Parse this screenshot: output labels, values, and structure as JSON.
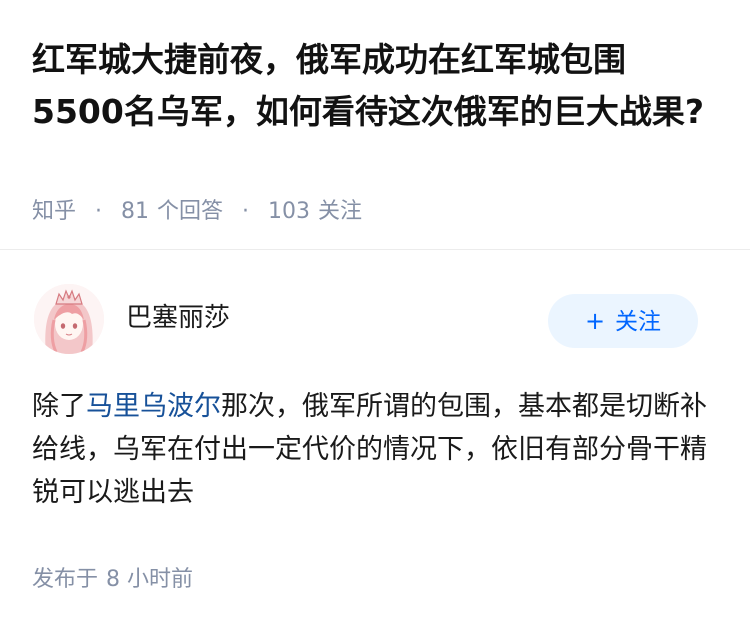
{
  "question": {
    "title": "红军城大捷前夜，俄军成功在红军城包围5500名乌军，如何看待这次俄军的巨大战果?",
    "source": "知乎",
    "separator": "·",
    "answer_count": "81",
    "answer_unit": "个回答",
    "follower_count": "103",
    "follower_unit": "关注"
  },
  "author": {
    "name": "巴塞丽莎",
    "avatar_icon": "anime-girl-avatar-icon",
    "follow_button": {
      "icon": "plus-icon",
      "plus": "+",
      "label": "关注"
    }
  },
  "answer": {
    "prefix": "除了",
    "link_text": "马里乌波尔",
    "suffix": "那次，俄军所谓的包围，基本都是切断补给线，乌军在付出一定代价的情况下，依旧有部分骨干精锐可以逃出去",
    "publish_label": "发布于",
    "publish_time": "8 小时前"
  },
  "colors": {
    "accent": "#0066ff",
    "link": "#175199",
    "meta": "#8590a6",
    "follow_bg": "#ebf5ff"
  }
}
